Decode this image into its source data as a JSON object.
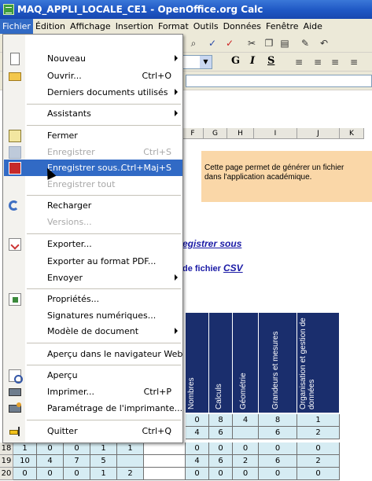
{
  "window": {
    "title": "MAQ_APPLI_LOCALE_CE1 - OpenOffice.org Calc"
  },
  "menubar": {
    "items": [
      "Fichier",
      "Édition",
      "Affichage",
      "Insertion",
      "Format",
      "Outils",
      "Données",
      "Fenêtre",
      "Aide"
    ],
    "active": "Fichier"
  },
  "menu": {
    "items": [
      {
        "label": "Nouveau",
        "shortcut": "",
        "icon": "new-document-icon",
        "submenu": true,
        "state": "normal"
      },
      {
        "label": "Ouvrir...",
        "shortcut": "Ctrl+O",
        "icon": "open-folder-icon",
        "submenu": false,
        "state": "normal"
      },
      {
        "label": "Derniers documents utilisés",
        "shortcut": "",
        "icon": "",
        "submenu": true,
        "state": "normal"
      },
      {
        "label": "Assistants",
        "shortcut": "",
        "icon": "",
        "submenu": true,
        "state": "normal"
      },
      {
        "label": "Fermer",
        "shortcut": "",
        "icon": "close-document-icon",
        "submenu": false,
        "state": "normal"
      },
      {
        "label": "Enregistrer",
        "shortcut": "Ctrl+S",
        "icon": "save-icon",
        "submenu": false,
        "state": "disabled"
      },
      {
        "label": "Enregistrer sous...",
        "shortcut": "Ctrl+Maj+S",
        "icon": "save-as-icon",
        "submenu": false,
        "state": "highlighted"
      },
      {
        "label": "Enregistrer tout",
        "shortcut": "",
        "icon": "",
        "submenu": false,
        "state": "disabled"
      },
      {
        "label": "Recharger",
        "shortcut": "",
        "icon": "reload-icon",
        "submenu": false,
        "state": "normal"
      },
      {
        "label": "Versions...",
        "shortcut": "",
        "icon": "",
        "submenu": false,
        "state": "disabled"
      },
      {
        "label": "Exporter...",
        "shortcut": "",
        "icon": "export-icon",
        "submenu": false,
        "state": "normal"
      },
      {
        "label": "Exporter au format PDF...",
        "shortcut": "",
        "icon": "",
        "submenu": false,
        "state": "normal"
      },
      {
        "label": "Envoyer",
        "shortcut": "",
        "icon": "",
        "submenu": true,
        "state": "normal"
      },
      {
        "label": "Propriétés...",
        "shortcut": "",
        "icon": "properties-icon",
        "submenu": false,
        "state": "normal"
      },
      {
        "label": "Signatures numériques...",
        "shortcut": "",
        "icon": "",
        "submenu": false,
        "state": "normal"
      },
      {
        "label": "Modèle de document",
        "shortcut": "",
        "icon": "",
        "submenu": true,
        "state": "normal"
      },
      {
        "label": "Aperçu dans le navigateur Web",
        "shortcut": "",
        "icon": "",
        "submenu": false,
        "state": "normal"
      },
      {
        "label": "Aperçu",
        "shortcut": "",
        "icon": "print-preview-icon",
        "submenu": false,
        "state": "normal"
      },
      {
        "label": "Imprimer...",
        "shortcut": "Ctrl+P",
        "icon": "printer-icon",
        "submenu": false,
        "state": "normal"
      },
      {
        "label": "Paramétrage de l'imprimante...",
        "shortcut": "",
        "icon": "printer-settings-icon",
        "submenu": false,
        "state": "normal"
      },
      {
        "label": "Quitter",
        "shortcut": "Ctrl+Q",
        "icon": "exit-icon",
        "submenu": false,
        "state": "normal"
      }
    ]
  },
  "toolbar": {
    "format_bold": "G",
    "format_italic": "I",
    "format_underline": "S"
  },
  "columns": [
    "F",
    "G",
    "H",
    "I",
    "J",
    "K"
  ],
  "sheet": {
    "info_text_1": "Cette page permet de générer un fichier",
    "info_text_2": "dans l'application académique.",
    "link_save_as": "egistrer sous",
    "line_csv_prefix": "de fichier ",
    "line_csv_link": "CSV",
    "header_columns": [
      "Nombres",
      "Calculs",
      "Géométrie",
      "Grandeurs et mesures",
      "Organisation et gestion de données"
    ]
  },
  "grid": {
    "rows": [
      {
        "num": "",
        "cells": [
          "",
          "",
          "",
          "",
          "",
          "0",
          "8",
          "4",
          "8",
          "1"
        ]
      },
      {
        "num": "",
        "cells": [
          "",
          "",
          "",
          "",
          "",
          "4",
          "6",
          "",
          "6",
          "2"
        ]
      },
      {
        "num": "18",
        "cells": [
          "1",
          "0",
          "0",
          "1",
          "1",
          "0",
          "0",
          "0",
          "0",
          "0"
        ]
      },
      {
        "num": "19",
        "cells": [
          "10",
          "4",
          "7",
          "5",
          "",
          "4",
          "6",
          "2",
          "6",
          "2"
        ]
      },
      {
        "num": "20",
        "cells": [
          "0",
          "0",
          "0",
          "1",
          "2",
          "0",
          "0",
          "0",
          "0",
          "0"
        ]
      }
    ]
  },
  "colors": {
    "highlight": "#316ac5",
    "title_bar": "#1f57c4",
    "header_band": "#1a2e6d",
    "info_box": "#fad7a8",
    "link": "#1a1aa6"
  }
}
